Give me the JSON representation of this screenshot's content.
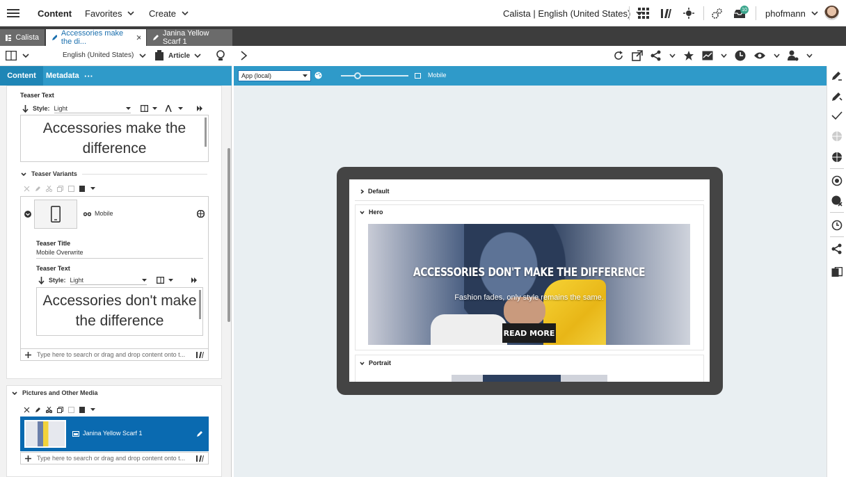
{
  "topbar": {
    "menu_icon": "hamburger-icon",
    "app_title": "Content",
    "favorites": "Favorites",
    "create": "Create",
    "site_locale": "Calista | English (United States)",
    "notification_count": "10",
    "user": "phofmann"
  },
  "tabs": [
    {
      "label": "Calista",
      "state": "inactive"
    },
    {
      "label": "Accessories make the di...",
      "state": "active"
    },
    {
      "label": "Janina Yellow Scarf 1",
      "state": "inactive"
    }
  ],
  "left_toolbar": {
    "locale": "English (United States)",
    "doctype": "Article"
  },
  "left_tabs": {
    "content": "Content",
    "metadata": "Metadata",
    "more": "···"
  },
  "editor": {
    "teaser_text_label": "Teaser Text",
    "style_label": "Style:",
    "style_value": "Light",
    "teaser_text_value": "Accessories make the difference",
    "teaser_variants_label": "Teaser Variants",
    "variant_name": "Mobile",
    "variant_teaser_title_label": "Teaser Title",
    "variant_teaser_title_value": "Mobile Overwrite",
    "variant_teaser_text_label": "Teaser Text",
    "variant_style_label": "Style:",
    "variant_style_value": "Light",
    "variant_teaser_text_value": "Accessories don't make the difference",
    "search_placeholder": "Type here to search or drag and drop content onto t...",
    "pictures_label": "Pictures and Other Media",
    "picture_item": "Janina Yellow Scarf 1",
    "pictures_search_placeholder": "Type here to search or drag and drop content onto t..."
  },
  "preview": {
    "app_select": "App (local)",
    "device_label": "Mobile",
    "zoom_level": 0.25,
    "sections": {
      "default": "Default",
      "hero": "Hero",
      "portrait": "Portrait"
    },
    "hero_headline": "ACCESSORIES DON'T MAKE THE DIFFERENCE",
    "hero_subline": "Fashion fades, only style remains the same.",
    "hero_button": "READ MORE"
  },
  "colors": {
    "accent": "#2f9ac9",
    "tab_active_text": "#1a6fae",
    "selected_item": "#0a6ab0",
    "badge": "#3aa58c"
  }
}
